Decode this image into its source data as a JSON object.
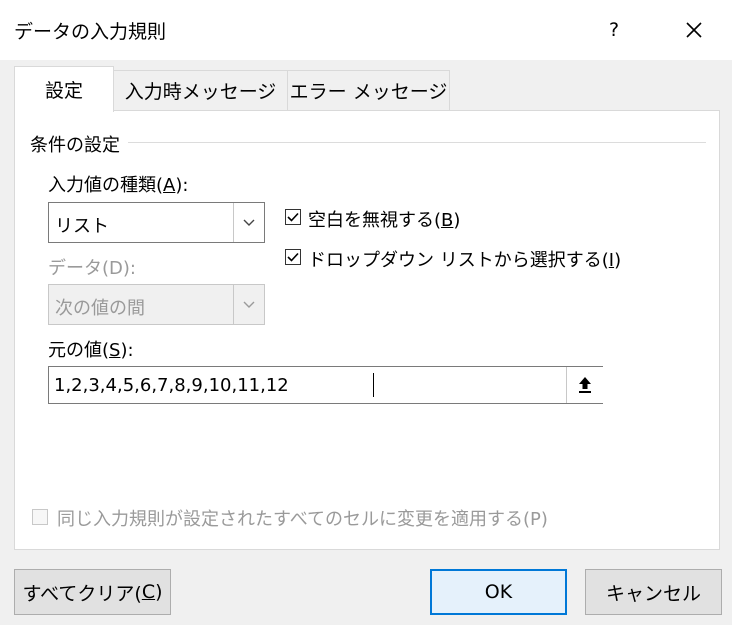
{
  "window": {
    "title": "データの入力規則",
    "help": "?",
    "close_icon": "close-icon"
  },
  "tabs": [
    {
      "label": "設定",
      "active": true
    },
    {
      "label": "入力時メッセージ",
      "active": false
    },
    {
      "label": "エラー メッセージ",
      "active": false
    }
  ],
  "settings": {
    "section_title": "条件の設定",
    "allow": {
      "label_pre": "入力値の種類(",
      "accel": "A",
      "label_post": "):",
      "value": "リスト"
    },
    "data": {
      "label": "データ(D):",
      "value": "次の値の間",
      "disabled": true
    },
    "ignore_blank": {
      "label_pre": "空白を無視する(",
      "accel": "B",
      "label_post": ")",
      "checked": true
    },
    "in_cell_dropdown": {
      "label_pre": "ドロップダウン リストから選択する(",
      "accel": "I",
      "label_post": ")",
      "checked": true
    },
    "source": {
      "label_pre": "元の値(",
      "accel": "S",
      "label_post": "):",
      "value": "1,2,3,4,5,6,7,8,9,10,11,12"
    },
    "apply_all": {
      "label": "同じ入力規則が設定されたすべてのセルに変更を適用する(P)",
      "checked": false,
      "disabled": true
    }
  },
  "buttons": {
    "clear_all": {
      "label_pre": "すべてクリア(",
      "accel": "C",
      "label_post": ")"
    },
    "ok": "OK",
    "cancel": "キャンセル"
  }
}
